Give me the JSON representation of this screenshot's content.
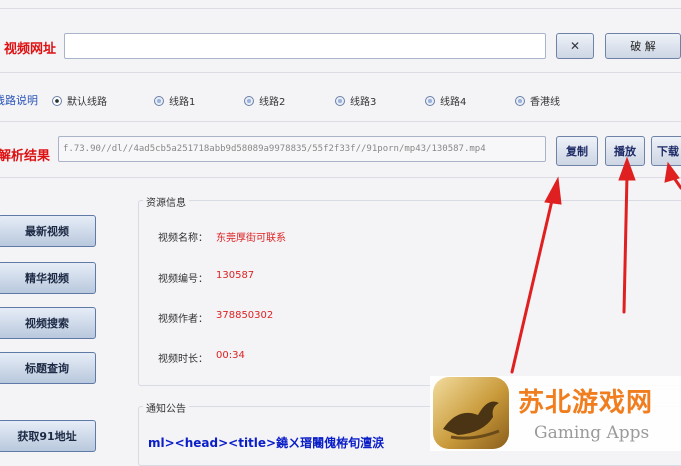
{
  "row1": {
    "label": "视频网址：",
    "url_value": "",
    "clear_symbol": "✕",
    "crack_label": "破 解"
  },
  "row2": {
    "label": "线路说明：",
    "options": [
      "默认线路",
      "线路1",
      "线路2",
      "线路3",
      "线路4",
      "香港线"
    ],
    "selected_index": 0
  },
  "row3": {
    "label": "解析结果：",
    "result_value": "f.73.90//dl//4ad5cb5a251718abb9d58089a9978835/55f2f33f//91porn/mp43/130587.mp4",
    "copy_label": "复制",
    "play_label": "播放",
    "download_label": "下载"
  },
  "sidebar": {
    "items": [
      "最新视频",
      "精华视频",
      "视频搜索",
      "标题查询",
      "获取91地址"
    ]
  },
  "resource": {
    "title": "资源信息",
    "fields": [
      {
        "key": "视频名称：",
        "value": "东莞厚街可联系"
      },
      {
        "key": "视频编号：",
        "value": "130587"
      },
      {
        "key": "视频作者：",
        "value": "378850302"
      },
      {
        "key": "视频时长：",
        "value": "00:34"
      }
    ]
  },
  "notice": {
    "title": "通知公告",
    "text": "ml><head><title>鐃ㄨ瑨闂傀栫旬澶涙"
  },
  "watermark": {
    "title": "苏北游戏网",
    "subtitle": "Gaming Apps"
  },
  "colors": {
    "accent_red": "#d11111",
    "label_blue": "#2b55b8",
    "arrow_red": "#e02020",
    "notice_blue": "#0a1ec8"
  }
}
